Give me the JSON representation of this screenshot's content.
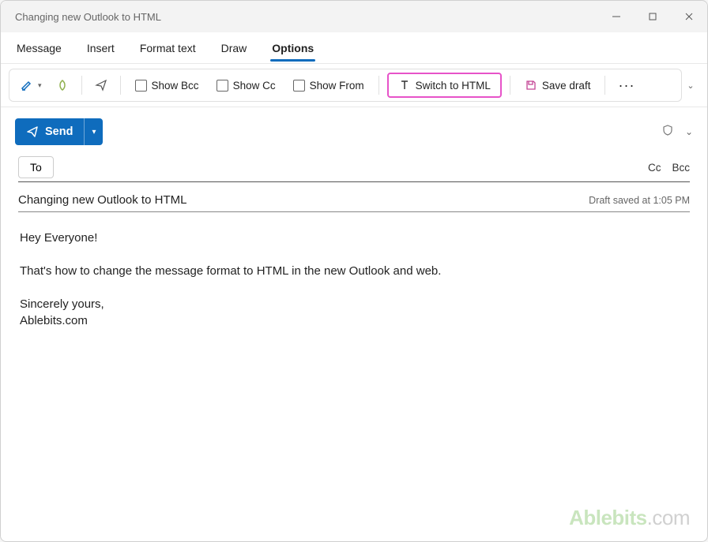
{
  "window": {
    "title": "Changing new Outlook to HTML"
  },
  "tabs": {
    "message": "Message",
    "insert": "Insert",
    "format_text": "Format text",
    "draw": "Draw",
    "options": "Options"
  },
  "ribbon": {
    "show_bcc": "Show Bcc",
    "show_cc": "Show Cc",
    "show_from": "Show From",
    "switch_html": "Switch to HTML",
    "save_draft": "Save draft"
  },
  "send": {
    "label": "Send"
  },
  "recipients": {
    "to_label": "To",
    "to_value": "",
    "cc_label": "Cc",
    "bcc_label": "Bcc"
  },
  "subject": {
    "text": "Changing new Outlook to HTML",
    "draft_status": "Draft saved at 1:05 PM"
  },
  "body": {
    "greeting": "Hey Everyone!",
    "main": "That's how to change the message format to HTML in the new Outlook and web.",
    "closing": "Sincerely yours,",
    "signature": "Ablebits.com"
  },
  "watermark": {
    "brand": "Ablebits",
    "domain": ".com"
  },
  "colors": {
    "accent": "#0f6cbd",
    "highlight": "#e753c9"
  }
}
